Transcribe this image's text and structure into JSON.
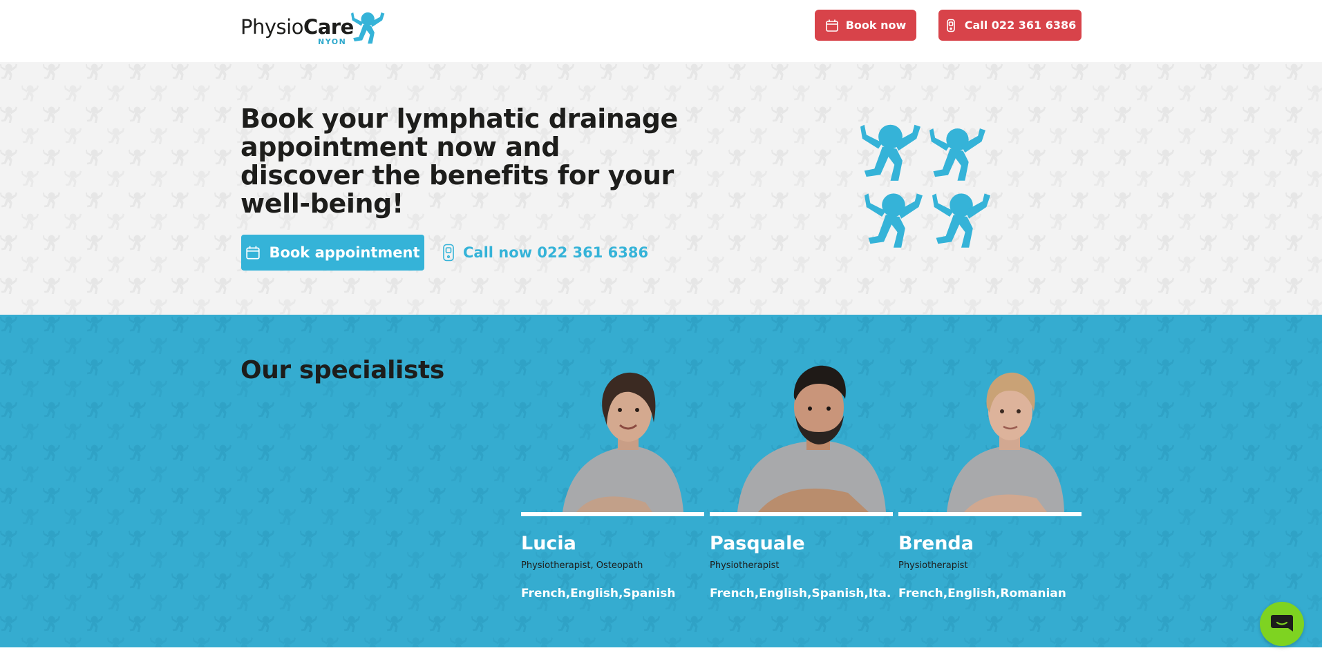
{
  "header": {
    "logo": {
      "text_light": "Physio",
      "text_bold": "Care",
      "sub": "NYON"
    },
    "book_now_label": "Book now",
    "call_label": "Call 022 361 6386",
    "calendar_icon": "calendar-icon",
    "phone_icon": "phone-icon"
  },
  "hero": {
    "title_bold": "Book your lymphatic drainage appointment",
    "title_rest": " now and discover the benefits for your well-being!",
    "book_appointment_label": "Book appointment",
    "call_now_label": "Call now 022 361 6386"
  },
  "specialists": {
    "title": "Our specialists",
    "people": [
      {
        "name": "Lucia",
        "role": "Physiotherapist, Osteopath",
        "languages": "French,English,Spanish"
      },
      {
        "name": "Pasquale",
        "role": "Physiotherapist",
        "languages": "French,English,Spanish,Ita."
      },
      {
        "name": "Brenda",
        "role": "Physiotherapist",
        "languages": "French,English,Romanian"
      }
    ]
  },
  "colors": {
    "brand_red": "#d8434a",
    "brand_blue": "#35b3d8",
    "section_blue": "#35acd0",
    "chat_green": "#7ed321"
  }
}
